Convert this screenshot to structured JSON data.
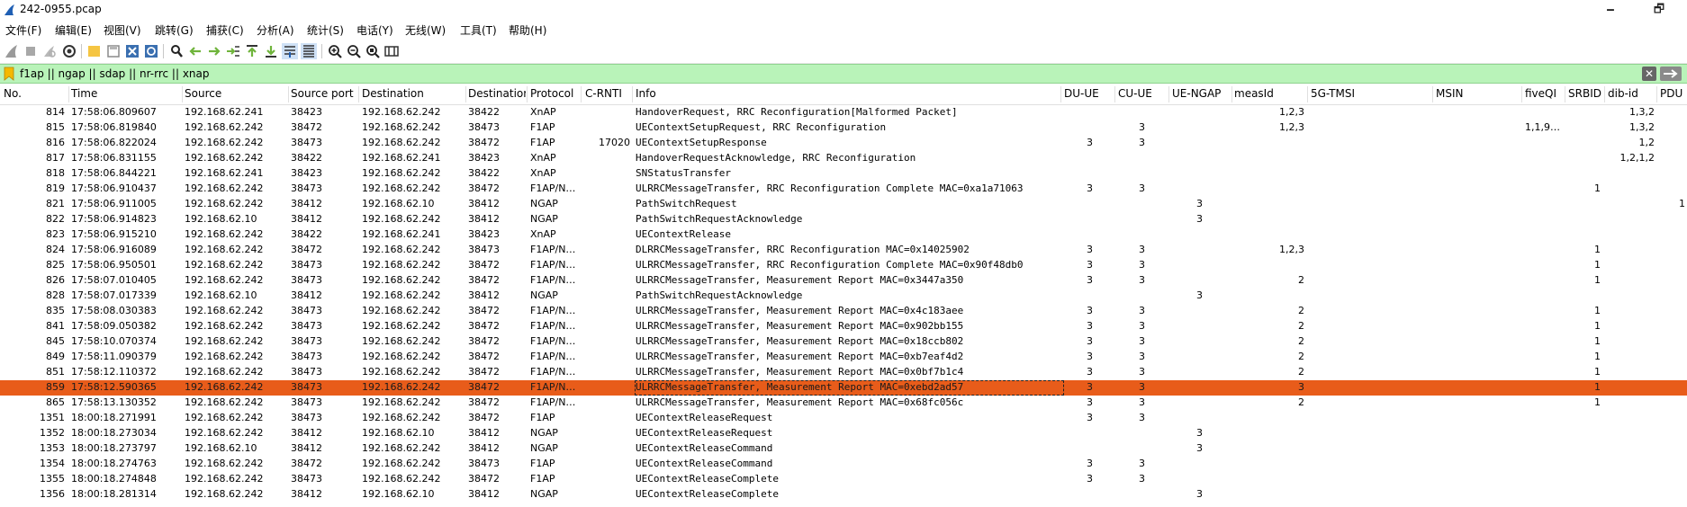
{
  "window": {
    "title": "242-0955.pcap",
    "minimize_glyph": "🗕",
    "restore_glyph": "🗗"
  },
  "menu": [
    "文件(F)",
    "编辑(E)",
    "视图(V)",
    "跳转(G)",
    "捕获(C)",
    "分析(A)",
    "统计(S)",
    "电话(Y)",
    "无线(W)",
    "工具(T)",
    "帮助(H)"
  ],
  "toolbar": {
    "icons": [
      "shark-fin-icon",
      "stop-icon",
      "restart-icon",
      "options-gear-icon",
      "open-folder-icon",
      "save-icon",
      "close-file-icon",
      "reload-icon",
      "find-icon",
      "back-icon",
      "forward-icon",
      "goto-icon",
      "first-packet-icon",
      "last-packet-icon",
      "autoscroll-icon",
      "colorize-icon",
      "zoom-in-icon",
      "zoom-out-icon",
      "zoom-normal-icon",
      "resize-columns-icon"
    ]
  },
  "filter": {
    "value": "f1ap || ngap || sdap || nr-rrc || xnap",
    "clear_glyph": "✕",
    "bg_color": "#b9f3b9"
  },
  "columns": [
    "No.",
    "Time",
    "Source",
    "Source port",
    "Destination",
    "Destinatior",
    "Protocol",
    "C-RNTI",
    "Info",
    "DU-UE",
    "CU-UE",
    "UE-NGAP",
    "measId",
    "5G-TMSI",
    "MSIN",
    "fiveQI",
    "SRBID",
    "dib-id",
    "PDU"
  ],
  "selection_color": "#e85c1a",
  "packets": [
    {
      "no": "814",
      "time": "17:58:06.809607",
      "src": "192.168.62.241",
      "sport": "38423",
      "dst": "192.168.62.242",
      "dport": "38422",
      "proto": "XnAP",
      "crnti": "",
      "info": "HandoverRequest, RRC Reconfiguration[Malformed Packet]",
      "du": "",
      "cu": "",
      "ngap": "",
      "meas": "1,2,3",
      "tmsi": "",
      "msin": "",
      "fiveqi": "",
      "srbid": "",
      "dib": "1,3,2",
      "pdu": ""
    },
    {
      "no": "815",
      "time": "17:58:06.819840",
      "src": "192.168.62.242",
      "sport": "38472",
      "dst": "192.168.62.242",
      "dport": "38473",
      "proto": "F1AP",
      "crnti": "",
      "info": "UEContextSetupRequest, RRC Reconfiguration",
      "du": "",
      "cu": "3",
      "ngap": "",
      "meas": "1,2,3",
      "tmsi": "",
      "msin": "",
      "fiveqi": "1,1,9…",
      "srbid": "",
      "dib": "1,3,2",
      "pdu": ""
    },
    {
      "no": "816",
      "time": "17:58:06.822024",
      "src": "192.168.62.242",
      "sport": "38473",
      "dst": "192.168.62.242",
      "dport": "38472",
      "proto": "F1AP",
      "crnti": "17020",
      "info": "UEContextSetupResponse",
      "du": "3",
      "cu": "3",
      "ngap": "",
      "meas": "",
      "tmsi": "",
      "msin": "",
      "fiveqi": "",
      "srbid": "",
      "dib": "1,2",
      "pdu": ""
    },
    {
      "no": "817",
      "time": "17:58:06.831155",
      "src": "192.168.62.242",
      "sport": "38422",
      "dst": "192.168.62.241",
      "dport": "38423",
      "proto": "XnAP",
      "crnti": "",
      "info": "HandoverRequestAcknowledge, RRC Reconfiguration",
      "du": "",
      "cu": "",
      "ngap": "",
      "meas": "",
      "tmsi": "",
      "msin": "",
      "fiveqi": "",
      "srbid": "",
      "dib": "1,2,1,2",
      "pdu": ""
    },
    {
      "no": "818",
      "time": "17:58:06.844221",
      "src": "192.168.62.241",
      "sport": "38423",
      "dst": "192.168.62.242",
      "dport": "38422",
      "proto": "XnAP",
      "crnti": "",
      "info": "SNStatusTransfer",
      "du": "",
      "cu": "",
      "ngap": "",
      "meas": "",
      "tmsi": "",
      "msin": "",
      "fiveqi": "",
      "srbid": "",
      "dib": "",
      "pdu": ""
    },
    {
      "no": "819",
      "time": "17:58:06.910437",
      "src": "192.168.62.242",
      "sport": "38473",
      "dst": "192.168.62.242",
      "dport": "38472",
      "proto": "F1AP/N…",
      "crnti": "",
      "info": "ULRRCMessageTransfer, RRC Reconfiguration Complete MAC=0xa1a71063",
      "du": "3",
      "cu": "3",
      "ngap": "",
      "meas": "",
      "tmsi": "",
      "msin": "",
      "fiveqi": "",
      "srbid": "1",
      "dib": "",
      "pdu": ""
    },
    {
      "no": "821",
      "time": "17:58:06.911005",
      "src": "192.168.62.242",
      "sport": "38412",
      "dst": "192.168.62.10",
      "dport": "38412",
      "proto": "NGAP",
      "crnti": "",
      "info": "PathSwitchRequest",
      "du": "",
      "cu": "",
      "ngap": "3",
      "meas": "",
      "tmsi": "",
      "msin": "",
      "fiveqi": "",
      "srbid": "",
      "dib": "",
      "pdu": "1"
    },
    {
      "no": "822",
      "time": "17:58:06.914823",
      "src": "192.168.62.10",
      "sport": "38412",
      "dst": "192.168.62.242",
      "dport": "38412",
      "proto": "NGAP",
      "crnti": "",
      "info": "PathSwitchRequestAcknowledge",
      "du": "",
      "cu": "",
      "ngap": "3",
      "meas": "",
      "tmsi": "",
      "msin": "",
      "fiveqi": "",
      "srbid": "",
      "dib": "",
      "pdu": ""
    },
    {
      "no": "823",
      "time": "17:58:06.915210",
      "src": "192.168.62.242",
      "sport": "38422",
      "dst": "192.168.62.241",
      "dport": "38423",
      "proto": "XnAP",
      "crnti": "",
      "info": "UEContextRelease",
      "du": "",
      "cu": "",
      "ngap": "",
      "meas": "",
      "tmsi": "",
      "msin": "",
      "fiveqi": "",
      "srbid": "",
      "dib": "",
      "pdu": ""
    },
    {
      "no": "824",
      "time": "17:58:06.916089",
      "src": "192.168.62.242",
      "sport": "38472",
      "dst": "192.168.62.242",
      "dport": "38473",
      "proto": "F1AP/N…",
      "crnti": "",
      "info": "DLRRCMessageTransfer, RRC Reconfiguration MAC=0x14025902",
      "du": "3",
      "cu": "3",
      "ngap": "",
      "meas": "1,2,3",
      "tmsi": "",
      "msin": "",
      "fiveqi": "",
      "srbid": "1",
      "dib": "",
      "pdu": ""
    },
    {
      "no": "825",
      "time": "17:58:06.950501",
      "src": "192.168.62.242",
      "sport": "38473",
      "dst": "192.168.62.242",
      "dport": "38472",
      "proto": "F1AP/N…",
      "crnti": "",
      "info": "ULRRCMessageTransfer, RRC Reconfiguration Complete MAC=0x90f48db0",
      "du": "3",
      "cu": "3",
      "ngap": "",
      "meas": "",
      "tmsi": "",
      "msin": "",
      "fiveqi": "",
      "srbid": "1",
      "dib": "",
      "pdu": ""
    },
    {
      "no": "826",
      "time": "17:58:07.010405",
      "src": "192.168.62.242",
      "sport": "38473",
      "dst": "192.168.62.242",
      "dport": "38472",
      "proto": "F1AP/N…",
      "crnti": "",
      "info": "ULRRCMessageTransfer, Measurement Report MAC=0x3447a350",
      "du": "3",
      "cu": "3",
      "ngap": "",
      "meas": "2",
      "tmsi": "",
      "msin": "",
      "fiveqi": "",
      "srbid": "1",
      "dib": "",
      "pdu": ""
    },
    {
      "no": "828",
      "time": "17:58:07.017339",
      "src": "192.168.62.10",
      "sport": "38412",
      "dst": "192.168.62.242",
      "dport": "38412",
      "proto": "NGAP",
      "crnti": "",
      "info": "PathSwitchRequestAcknowledge",
      "du": "",
      "cu": "",
      "ngap": "3",
      "meas": "",
      "tmsi": "",
      "msin": "",
      "fiveqi": "",
      "srbid": "",
      "dib": "",
      "pdu": ""
    },
    {
      "no": "835",
      "time": "17:58:08.030383",
      "src": "192.168.62.242",
      "sport": "38473",
      "dst": "192.168.62.242",
      "dport": "38472",
      "proto": "F1AP/N…",
      "crnti": "",
      "info": "ULRRCMessageTransfer, Measurement Report MAC=0x4c183aee",
      "du": "3",
      "cu": "3",
      "ngap": "",
      "meas": "2",
      "tmsi": "",
      "msin": "",
      "fiveqi": "",
      "srbid": "1",
      "dib": "",
      "pdu": ""
    },
    {
      "no": "841",
      "time": "17:58:09.050382",
      "src": "192.168.62.242",
      "sport": "38473",
      "dst": "192.168.62.242",
      "dport": "38472",
      "proto": "F1AP/N…",
      "crnti": "",
      "info": "ULRRCMessageTransfer, Measurement Report MAC=0x902bb155",
      "du": "3",
      "cu": "3",
      "ngap": "",
      "meas": "2",
      "tmsi": "",
      "msin": "",
      "fiveqi": "",
      "srbid": "1",
      "dib": "",
      "pdu": ""
    },
    {
      "no": "845",
      "time": "17:58:10.070374",
      "src": "192.168.62.242",
      "sport": "38473",
      "dst": "192.168.62.242",
      "dport": "38472",
      "proto": "F1AP/N…",
      "crnti": "",
      "info": "ULRRCMessageTransfer, Measurement Report MAC=0x18ccb802",
      "du": "3",
      "cu": "3",
      "ngap": "",
      "meas": "2",
      "tmsi": "",
      "msin": "",
      "fiveqi": "",
      "srbid": "1",
      "dib": "",
      "pdu": ""
    },
    {
      "no": "849",
      "time": "17:58:11.090379",
      "src": "192.168.62.242",
      "sport": "38473",
      "dst": "192.168.62.242",
      "dport": "38472",
      "proto": "F1AP/N…",
      "crnti": "",
      "info": "ULRRCMessageTransfer, Measurement Report MAC=0xb7eaf4d2",
      "du": "3",
      "cu": "3",
      "ngap": "",
      "meas": "2",
      "tmsi": "",
      "msin": "",
      "fiveqi": "",
      "srbid": "1",
      "dib": "",
      "pdu": ""
    },
    {
      "no": "851",
      "time": "17:58:12.110372",
      "src": "192.168.62.242",
      "sport": "38473",
      "dst": "192.168.62.242",
      "dport": "38472",
      "proto": "F1AP/N…",
      "crnti": "",
      "info": "ULRRCMessageTransfer, Measurement Report MAC=0x0bf7b1c4",
      "du": "3",
      "cu": "3",
      "ngap": "",
      "meas": "2",
      "tmsi": "",
      "msin": "",
      "fiveqi": "",
      "srbid": "1",
      "dib": "",
      "pdu": ""
    },
    {
      "no": "859",
      "time": "17:58:12.590365",
      "src": "192.168.62.242",
      "sport": "38473",
      "dst": "192.168.62.242",
      "dport": "38472",
      "proto": "F1AP/N…",
      "crnti": "",
      "info": "ULRRCMessageTransfer, Measurement Report MAC=0xebd2ad57",
      "du": "3",
      "cu": "3",
      "ngap": "",
      "meas": "3",
      "tmsi": "",
      "msin": "",
      "fiveqi": "",
      "srbid": "1",
      "dib": "",
      "pdu": "",
      "selected": true
    },
    {
      "no": "865",
      "time": "17:58:13.130352",
      "src": "192.168.62.242",
      "sport": "38473",
      "dst": "192.168.62.242",
      "dport": "38472",
      "proto": "F1AP/N…",
      "crnti": "",
      "info": "ULRRCMessageTransfer, Measurement Report MAC=0x68fc056c",
      "du": "3",
      "cu": "3",
      "ngap": "",
      "meas": "2",
      "tmsi": "",
      "msin": "",
      "fiveqi": "",
      "srbid": "1",
      "dib": "",
      "pdu": ""
    },
    {
      "no": "1351",
      "time": "18:00:18.271991",
      "src": "192.168.62.242",
      "sport": "38473",
      "dst": "192.168.62.242",
      "dport": "38472",
      "proto": "F1AP",
      "crnti": "",
      "info": "UEContextReleaseRequest",
      "du": "3",
      "cu": "3",
      "ngap": "",
      "meas": "",
      "tmsi": "",
      "msin": "",
      "fiveqi": "",
      "srbid": "",
      "dib": "",
      "pdu": ""
    },
    {
      "no": "1352",
      "time": "18:00:18.273034",
      "src": "192.168.62.242",
      "sport": "38412",
      "dst": "192.168.62.10",
      "dport": "38412",
      "proto": "NGAP",
      "crnti": "",
      "info": "UEContextReleaseRequest",
      "du": "",
      "cu": "",
      "ngap": "3",
      "meas": "",
      "tmsi": "",
      "msin": "",
      "fiveqi": "",
      "srbid": "",
      "dib": "",
      "pdu": ""
    },
    {
      "no": "1353",
      "time": "18:00:18.273797",
      "src": "192.168.62.10",
      "sport": "38412",
      "dst": "192.168.62.242",
      "dport": "38412",
      "proto": "NGAP",
      "crnti": "",
      "info": "UEContextReleaseCommand",
      "du": "",
      "cu": "",
      "ngap": "3",
      "meas": "",
      "tmsi": "",
      "msin": "",
      "fiveqi": "",
      "srbid": "",
      "dib": "",
      "pdu": ""
    },
    {
      "no": "1354",
      "time": "18:00:18.274763",
      "src": "192.168.62.242",
      "sport": "38472",
      "dst": "192.168.62.242",
      "dport": "38473",
      "proto": "F1AP",
      "crnti": "",
      "info": "UEContextReleaseCommand",
      "du": "3",
      "cu": "3",
      "ngap": "",
      "meas": "",
      "tmsi": "",
      "msin": "",
      "fiveqi": "",
      "srbid": "",
      "dib": "",
      "pdu": ""
    },
    {
      "no": "1355",
      "time": "18:00:18.274848",
      "src": "192.168.62.242",
      "sport": "38473",
      "dst": "192.168.62.242",
      "dport": "38472",
      "proto": "F1AP",
      "crnti": "",
      "info": "UEContextReleaseComplete",
      "du": "3",
      "cu": "3",
      "ngap": "",
      "meas": "",
      "tmsi": "",
      "msin": "",
      "fiveqi": "",
      "srbid": "",
      "dib": "",
      "pdu": ""
    },
    {
      "no": "1356",
      "time": "18:00:18.281314",
      "src": "192.168.62.242",
      "sport": "38412",
      "dst": "192.168.62.10",
      "dport": "38412",
      "proto": "NGAP",
      "crnti": "",
      "info": "UEContextReleaseComplete",
      "du": "",
      "cu": "",
      "ngap": "3",
      "meas": "",
      "tmsi": "",
      "msin": "",
      "fiveqi": "",
      "srbid": "",
      "dib": "",
      "pdu": ""
    }
  ]
}
